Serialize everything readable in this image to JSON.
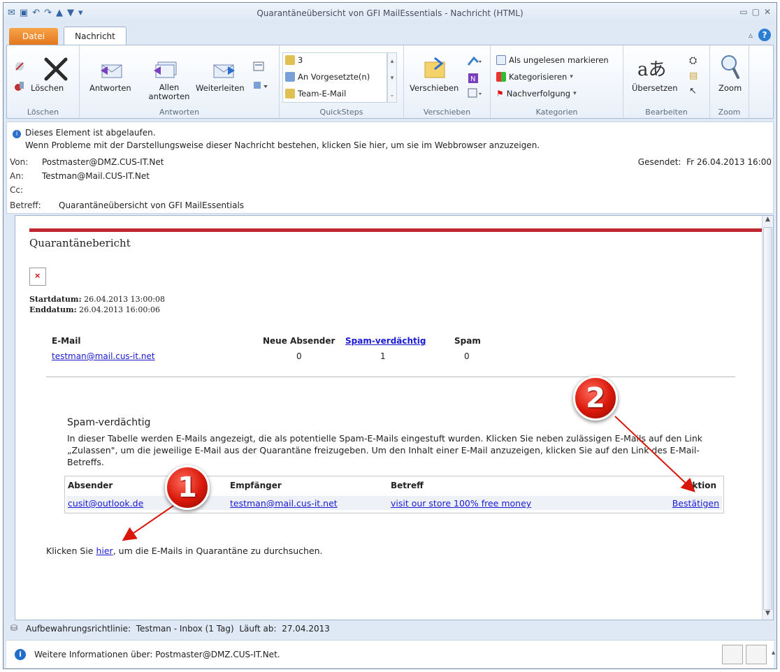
{
  "window": {
    "title": "Quarantäneübersicht von GFI MailEssentials  -  Nachricht (HTML)"
  },
  "tabs": {
    "file": "Datei",
    "message": "Nachricht"
  },
  "ribbon": {
    "groups": {
      "delete": {
        "label": "Löschen",
        "delete_btn": "Löschen"
      },
      "respond": {
        "label": "Antworten",
        "reply": "Antworten",
        "reply_all": "Allen antworten",
        "forward": "Weiterleiten"
      },
      "quicksteps": {
        "label": "QuickSteps",
        "item1": "3",
        "item2": "An Vorgesetzte(n)",
        "item3": "Team-E-Mail"
      },
      "move": {
        "label": "Verschieben",
        "move_btn": "Verschieben"
      },
      "tags": {
        "label": "Kategorien",
        "mark_unread": "Als ungelesen markieren",
        "categorize": "Kategorisieren",
        "followup": "Nachverfolgung"
      },
      "edit": {
        "label": "Bearbeiten",
        "translate": "Übersetzen"
      },
      "zoom": {
        "label": "Zoom",
        "zoom_btn": "Zoom"
      }
    }
  },
  "header": {
    "expired": "Dieses Element ist abgelaufen.",
    "browser_hint": "Wenn Probleme mit der Darstellungsweise dieser Nachricht bestehen, klicken Sie hier, um sie im Webbrowser anzuzeigen.",
    "from_label": "Von:",
    "from": "Postmaster@DMZ.CUS-IT.Net",
    "to_label": "An:",
    "to": "Testman@Mail.CUS-IT.Net",
    "cc_label": "Cc:",
    "subject_label": "Betreff:",
    "subject": "Quarantäneübersicht von GFI MailEssentials",
    "sent_label": "Gesendet:",
    "sent": "Fr 26.04.2013 16:00"
  },
  "report": {
    "title": "Quarantänebericht",
    "start_label": "Startdatum:",
    "start": "26.04.2013 13:00:08",
    "end_label": "Enddatum:",
    "end": "26.04.2013 16:00:06",
    "summary": {
      "headers": [
        "E-Mail",
        "Neue Absender",
        "Spam-verdächtig",
        "Spam"
      ],
      "row": [
        "testman@mail.cus-it.net",
        "0",
        "1",
        "0"
      ]
    },
    "spam_title": "Spam-verdächtig",
    "spam_desc": "In dieser Tabelle werden E-Mails angezeigt, die als potentielle Spam-E-Mails eingestuft wurden. Klicken Sie neben zulässigen E-Mails auf den Link „Zulassen\", um die jeweilige E-Mail aus der Quarantäne freizugeben. Um den Inhalt einer E-Mail anzuzeigen, klicken Sie auf den Link des E-Mail-Betreffs.",
    "table": {
      "headers": [
        "Absender",
        "Empfänger",
        "Betreff",
        "Aktion"
      ],
      "row": [
        "cusit@outlook.de",
        "testman@mail.cus-it.net",
        "visit our store 100% free money",
        "Bestätigen"
      ]
    },
    "hint_pre": "Klicken Sie ",
    "hint_link": "hier",
    "hint_post": ", um die E-Mails in Quarantäne zu durchsuchen."
  },
  "markers": [
    "1",
    "2"
  ],
  "policy": {
    "label": "Aufbewahrungsrichtlinie:",
    "value": "Testman - Inbox (1 Tag)",
    "expires_label": "Läuft ab:",
    "expires": "27.04.2013"
  },
  "infobar": {
    "text": "Weitere Informationen über: Postmaster@DMZ.CUS-IT.Net."
  },
  "colors": {
    "accent_red": "#c0262d",
    "link_blue": "#1b1bd3",
    "file_tab": "#e4761b"
  }
}
